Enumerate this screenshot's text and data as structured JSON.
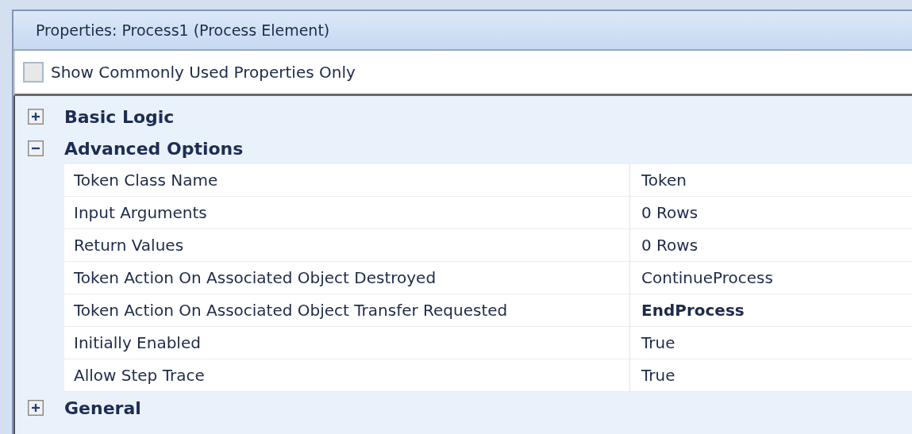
{
  "panel": {
    "title": "Properties: Process1 (Process Element)"
  },
  "filter": {
    "label": "Show Commonly Used Properties Only",
    "checked": false
  },
  "categories": [
    {
      "name": "Basic Logic",
      "expanded": false
    },
    {
      "name": "Advanced Options",
      "expanded": true,
      "properties": [
        {
          "name": "Token Class Name",
          "value": "Token",
          "modified": false
        },
        {
          "name": "Input Arguments",
          "value": "0 Rows",
          "modified": false
        },
        {
          "name": "Return Values",
          "value": "0 Rows",
          "modified": false
        },
        {
          "name": "Token Action On Associated Object Destroyed",
          "value": "ContinueProcess",
          "modified": false
        },
        {
          "name": "Token Action On Associated Object Transfer Requested",
          "value": "EndProcess",
          "modified": true
        },
        {
          "name": "Initially Enabled",
          "value": "True",
          "modified": false
        },
        {
          "name": "Allow Step Trace",
          "value": "True",
          "modified": false
        }
      ]
    },
    {
      "name": "General",
      "expanded": false
    }
  ]
}
